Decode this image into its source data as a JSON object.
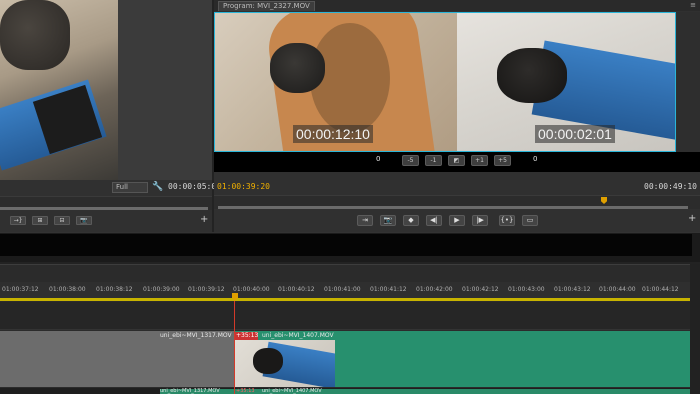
{
  "source": {
    "zoom": "Full",
    "timecode": "00:00:05:05",
    "buttons": [
      "→}",
      "⊞",
      "⊟",
      "📷"
    ]
  },
  "program": {
    "tab_label": "Program: MVI_2327.MOV",
    "left_timecode": "00:00:12:10",
    "right_timecode": "00:00:02:01",
    "trim_left_value": "0",
    "trim_right_value": "0",
    "trim_buttons": [
      "-5",
      "-1",
      "◩",
      "+1",
      "+5"
    ],
    "current_timecode": "01:00:39:20",
    "duration_timecode": "00:00:49:10",
    "transport_buttons": [
      "⇥",
      "📷",
      "◆",
      "◀|",
      "▶",
      "|▶",
      "{•}",
      "▭"
    ]
  },
  "timeline": {
    "ruler_ticks": [
      "01:00:37:12",
      "01:00:38:00",
      "01:00:38:12",
      "01:00:39:00",
      "01:00:39:12",
      "01:00:40:00",
      "01:00:40:12",
      "01:00:41:00",
      "01:00:41:12",
      "01:00:42:00",
      "01:00:42:12",
      "01:00:43:00",
      "01:00:43:12",
      "01:00:44:00",
      "01:00:44:12"
    ],
    "clip_grey_label": "uni_ebi~MVI_1317.MOV",
    "clip_green_label": "uni_ebi~MVI_1407.MOV",
    "clip_red_label": "+35:13",
    "bottom_labels": [
      "uni_ebi~MVI_1317.MOV",
      "+35:13",
      "uni_ebi~MVI_1407.MOV"
    ]
  },
  "colors": {
    "accent_timecode": "#f0b000",
    "selection": "#2ab5d8",
    "clip_green": "#27906e",
    "playhead": "#d23a2a"
  }
}
